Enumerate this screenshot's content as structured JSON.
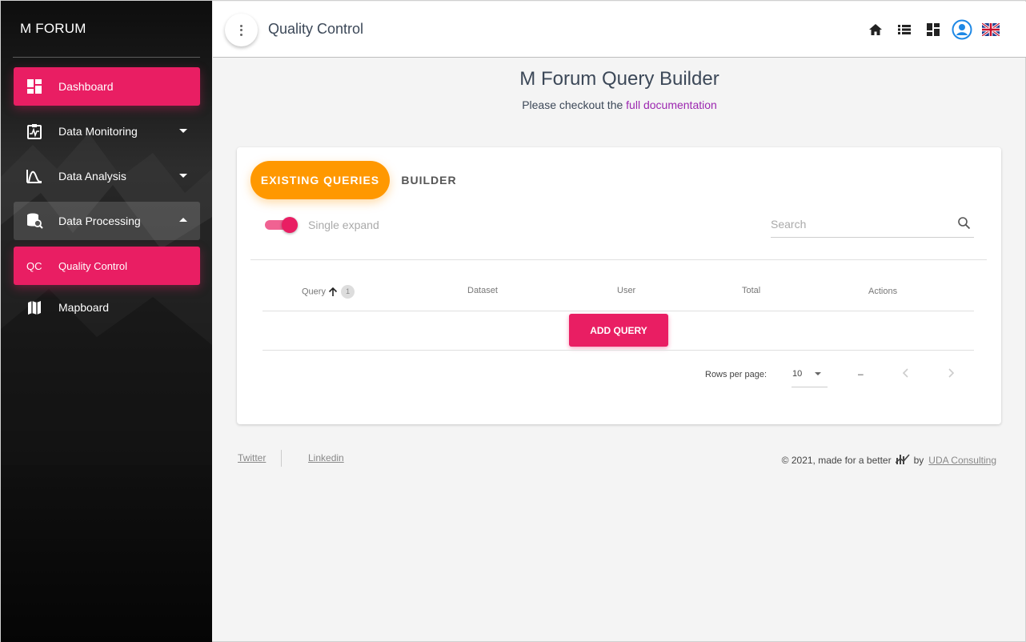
{
  "sidebar": {
    "brand": "M FORUM",
    "items": [
      {
        "label": "Dashboard",
        "icon": "dashboard-icon"
      },
      {
        "label": "Data Monitoring",
        "icon": "monitor-icon"
      },
      {
        "label": "Data Analysis",
        "icon": "analysis-icon"
      },
      {
        "label": "Data Processing",
        "icon": "processing-icon"
      },
      {
        "label": "Quality Control",
        "abbr": "QC"
      },
      {
        "label": "Mapboard",
        "icon": "map-icon"
      }
    ]
  },
  "header": {
    "title": "Quality Control",
    "icons": [
      "home-icon",
      "list-icon",
      "dashboard-grid-icon",
      "user-account-icon",
      "uk-flag-icon"
    ]
  },
  "main": {
    "title": "M Forum Query Builder",
    "subtitle_prefix": "Please checkout the",
    "subtitle_link": "full documentation",
    "tabs": [
      {
        "label": "EXISTING QUERIES"
      },
      {
        "label": "BUILDER"
      }
    ],
    "single_expand_label": "Single expand",
    "search_placeholder": "Search",
    "table": {
      "columns": [
        "Query",
        "Dataset",
        "User",
        "Total",
        "Actions"
      ],
      "sort_badge": "1"
    },
    "add_query_label": "ADD QUERY",
    "pagination": {
      "rows_per_page_label": "Rows per page:",
      "rows_per_page_value": "10",
      "range": "–"
    }
  },
  "footer": {
    "links": [
      "Twitter",
      "Linkedin"
    ],
    "copyright_text": "© 2021, made for a better",
    "by_text": "by",
    "company": "UDA Consulting"
  },
  "colors": {
    "primary": "#e91e63",
    "tab_active": "#ff9800",
    "link": "#9c27b0"
  }
}
